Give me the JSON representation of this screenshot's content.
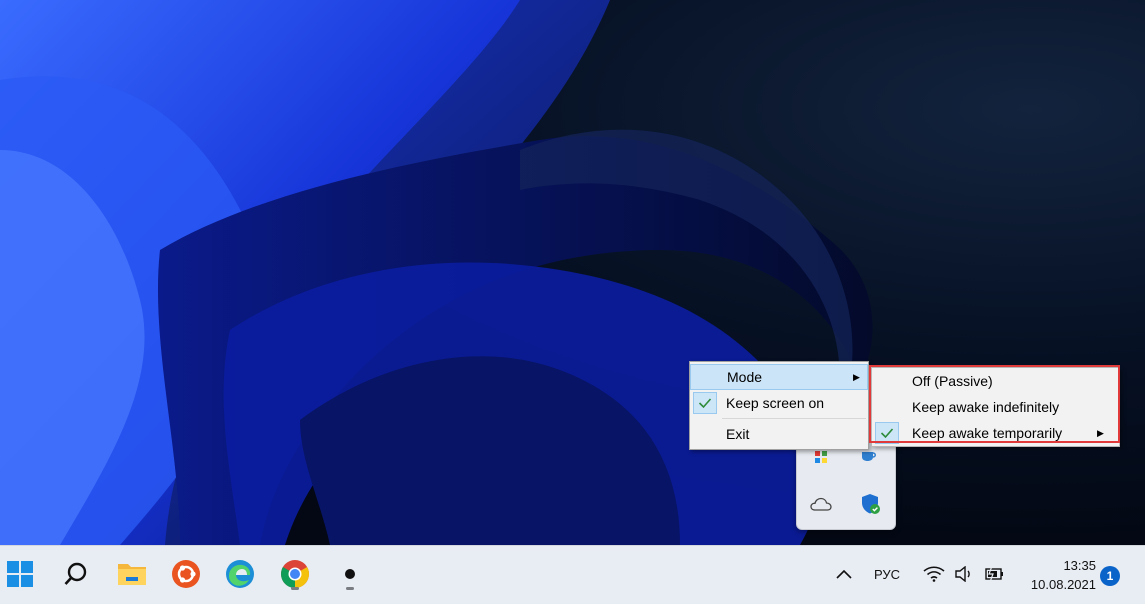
{
  "context_menu": {
    "items": [
      {
        "label": "Mode",
        "has_submenu": true,
        "highlighted": true,
        "checked": false
      },
      {
        "label": "Keep screen on",
        "has_submenu": false,
        "highlighted": false,
        "checked": true
      },
      {
        "label": "Exit",
        "has_submenu": false,
        "highlighted": false,
        "checked": false
      }
    ]
  },
  "mode_submenu": {
    "items": [
      {
        "label": "Off (Passive)",
        "checked": false,
        "has_submenu": false
      },
      {
        "label": "Keep awake indefinitely",
        "checked": false,
        "has_submenu": false
      },
      {
        "label": "Keep awake temporarily",
        "checked": true,
        "has_submenu": true
      }
    ]
  },
  "tray_overflow": {
    "icons": [
      "color-picker-icon",
      "coffee-cup-icon",
      "onedrive-cloud-icon",
      "defender-shield-icon"
    ]
  },
  "taskbar": {
    "apps": [
      {
        "name": "start-button",
        "running": false
      },
      {
        "name": "search-button",
        "running": false
      },
      {
        "name": "file-explorer-button",
        "running": false
      },
      {
        "name": "ubuntu-button",
        "running": false
      },
      {
        "name": "edge-button",
        "running": false
      },
      {
        "name": "chrome-button",
        "running": true
      },
      {
        "name": "terminal-button",
        "running": true
      }
    ],
    "language": "РУС",
    "time": "13:35",
    "date": "10.08.2021",
    "notification_count": "1"
  },
  "colors": {
    "accent": "#0a63c9",
    "highlight_box": "#e03a3a",
    "check": "#2e8b3a"
  }
}
